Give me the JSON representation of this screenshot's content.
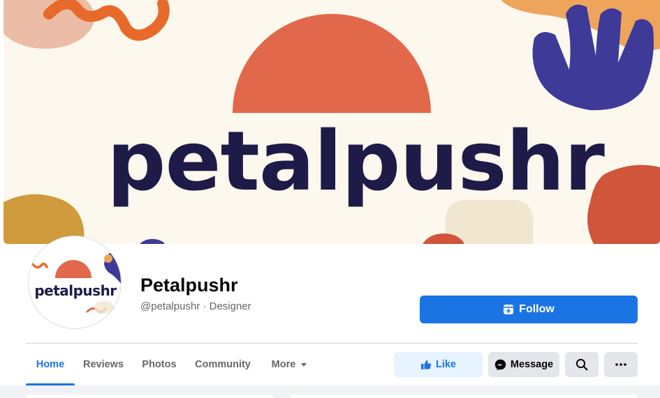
{
  "cover": {
    "wordmark": "petalpushr"
  },
  "avatar": {
    "wordmark": "petalpushr"
  },
  "profile": {
    "name": "Petalpushr",
    "subtitle": "@petalpushr · Designer"
  },
  "follow_button": {
    "label": "Follow",
    "icon": "follow-page-icon"
  },
  "tabs": [
    {
      "label": "Home",
      "active": true
    },
    {
      "label": "Reviews",
      "active": false
    },
    {
      "label": "Photos",
      "active": false
    },
    {
      "label": "Community",
      "active": false
    },
    {
      "label": "More",
      "active": false,
      "icon": "caret-down-icon"
    }
  ],
  "actions": {
    "like": {
      "label": "Like",
      "icon": "thumbs-up-icon"
    },
    "message": {
      "label": "Message",
      "icon": "messenger-icon"
    },
    "search": {
      "icon": "search-icon"
    },
    "more": {
      "icon": "more-dots-icon"
    }
  },
  "colors": {
    "accent": "#1b74e4",
    "brand_navy": "#1e1b48",
    "brand_orange": "#e2684b",
    "brand_purple": "#3d3a98",
    "cover_bg": "#fdf8ee"
  }
}
